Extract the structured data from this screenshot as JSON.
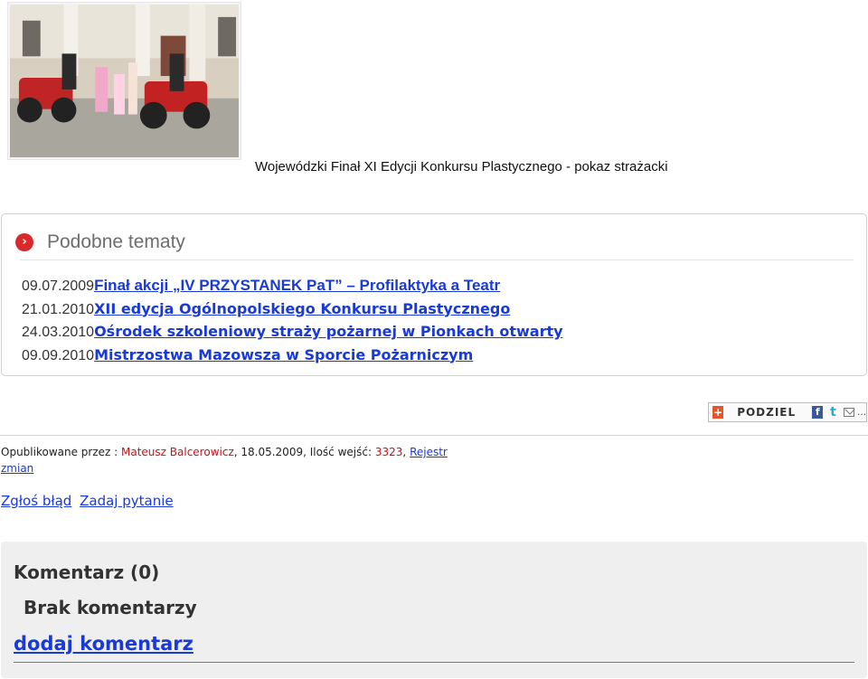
{
  "article": {
    "caption": "Wojewódzki Finał XI Edycji Konkursu Plastycznego - pokaz strażacki"
  },
  "related": {
    "title": "Podobne tematy",
    "items": [
      {
        "date": "09.07.2009",
        "title": "Finał akcji „IV PRZYSTANEK PaT” – Profilaktyka a Teatr"
      },
      {
        "date": "21.01.2010",
        "title": "XII edycja Ogólnopolskiego Konkursu Plastycznego"
      },
      {
        "date": "24.03.2010",
        "title": "Ośrodek szkoleniowy straży pożarnej w Pionkach otwarty"
      },
      {
        "date": "09.09.2010",
        "title": "Mistrzostwa Mazowsza w Sporcie Pożarniczym"
      }
    ]
  },
  "share": {
    "label": "PODZIEL",
    "icons": [
      "plus-icon",
      "facebook-icon",
      "twitter-icon",
      "mail-icon",
      "more-icon"
    ]
  },
  "meta": {
    "published_by_label": "Opublikowane przez :",
    "author": "Mateusz Balcerowicz",
    "date": ", 18.05.2009, Ilość wejść:",
    "views": "3323",
    "comma": ",",
    "register_link": "Rejestr zmian"
  },
  "actions": {
    "report_error": "Zgłoś błąd",
    "ask_question": "Zadaj pytanie"
  },
  "comments": {
    "title": "Komentarz (0)",
    "empty": "Brak komentarzy",
    "add": "dodaj komentarz"
  },
  "colors": {
    "link": "#1a3ad6",
    "accent_red": "#d82a2a",
    "meta_red": "#c0141a",
    "comments_bg": "#efefef"
  }
}
